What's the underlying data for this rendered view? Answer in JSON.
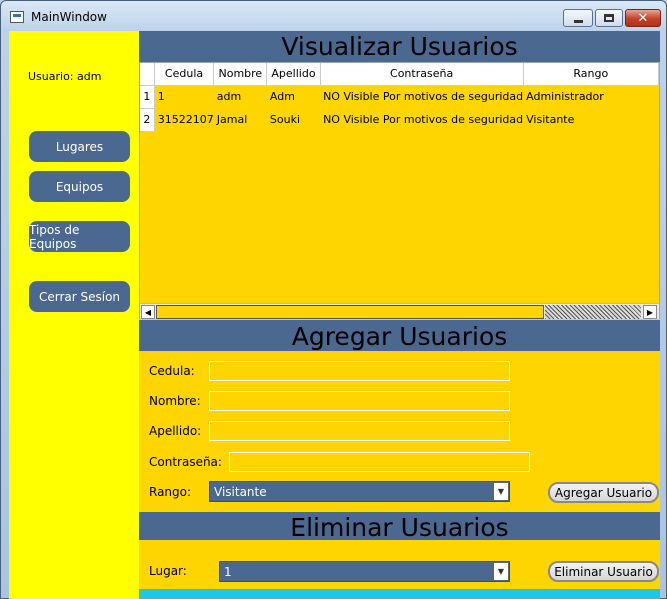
{
  "window": {
    "title": "MainWindow"
  },
  "sidebar": {
    "user_label": "Usuario: adm",
    "buttons": [
      "Lugares",
      "Equipos",
      "Tipos de Equipos",
      "Cerrar Sesíon"
    ]
  },
  "view_section": {
    "title": "Visualizar Usuarios",
    "columns": [
      "Cedula",
      "Nombre",
      "Apellido",
      "Contraseña",
      "Rango"
    ],
    "rows": [
      {
        "num": "1",
        "cedula": "1",
        "nombre": "adm",
        "apellido": "Adm",
        "contrasena": "NO Visible Por motivos de seguridad",
        "rango": "Administrador"
      },
      {
        "num": "2",
        "cedula": "31522107",
        "nombre": "Jamal",
        "apellido": "Souki",
        "contrasena": "NO Visible Por motivos de seguridad",
        "rango": "Visitante"
      }
    ]
  },
  "add_section": {
    "title": "Agregar Usuarios",
    "cedula_label": "Cedula:",
    "nombre_label": "Nombre:",
    "apellido_label": "Apellido:",
    "contrasena_label": "Contraseña:",
    "rango_label": "Rango:",
    "rango_value": "Visitante",
    "add_button": "Agregar Usuario"
  },
  "delete_section": {
    "title": "Eliminar Usuarios",
    "lugar_label": "Lugar:",
    "lugar_value": "1",
    "delete_button": "Eliminar Usuario"
  },
  "colors": {
    "accent": "#4a6890",
    "panel": "#ffd500",
    "sidebar": "#ffff00"
  }
}
